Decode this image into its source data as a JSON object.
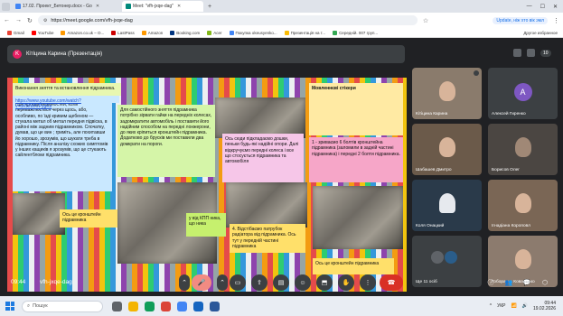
{
  "browser": {
    "tabs": [
      {
        "label": "17.02. Проект_Бетонер.docx - Go",
        "color": "#4285f4"
      },
      {
        "label": "Meet: \"vfh-jxqe-dag\"",
        "color": "#00897b",
        "active": true
      }
    ],
    "new_tab": "+",
    "url": "https://meet.google.com/vfh-jxqe-dag",
    "update_label": "Update, ніж хто вік эмл",
    "bookmarks": [
      {
        "label": "Gmail",
        "color": "#ea4335"
      },
      {
        "label": "YouTube",
        "color": "#ff0000"
      },
      {
        "label": "Amazon.co.uk – O...",
        "color": "#ff9900"
      },
      {
        "label": "LastPass",
        "color": "#cc0000"
      },
      {
        "label": "Amazon",
        "color": "#ff9900"
      },
      {
        "label": "Booking.com",
        "color": "#003580"
      },
      {
        "label": "Acer",
        "color": "#83b81a"
      },
      {
        "label": "Покупка okeusyenko...",
        "color": "#4285f4"
      },
      {
        "label": "Презентація на т...",
        "color": "#fbbc04"
      },
      {
        "label": "Середній. 007 груп...",
        "color": "#34a853"
      }
    ],
    "bookmarks_right": "Другое избранное"
  },
  "meet": {
    "presenter_initial": "K",
    "presenter_label": "Кітіцина Карина (Презентація)",
    "participant_count": "10",
    "time": "09:44",
    "meeting_code": "vfh-jxqe-dag"
  },
  "slide": {
    "title": "Виконання зняття та встановлення підрамника.",
    "note1": "При проїзді нерівностей, коли переважлюється через щось, або, особливо, по їзді кривим щебеном — стукала метал об метал передня підвіска, в районі між задним підрамником. Спочатку, думав, що це вин ; гриміть, але похитавши йо хорошо, зрозумів, що шукати треба в підрамнику. Після аналізу схожих симптомів у інших кащиків я зрозумів, що це стукають сайлентблоки підрамника.",
    "link": "https://www.youtube.com/watch?v=oKWWfVPygKs",
    "note2": "Для самостійного зняття підрамника потрібно зірвати гайки на передніх колесах, задомкратити автомобіль і поставити його надійним способом на передні лонжерони, до яких кріпиться кронштейн підрамника. Додатково до брусків ми поставили два домкрати на пороги.",
    "note3": "Ось сюди підкладаємо дошки, пеньки будь-які надійні опори. Далі відкручуємо передні колеса і все що стосується підрамника та автомобіля",
    "note4": "1 - зриваємо 6 болтів кронштейна підрамника (заломили в задній частині підрамника) і передні 2 болти підрамника.",
    "note5": "Ось це кронштейн підрамника",
    "note6": "4. Відстібаємо патрубок радіатора від підрамника. Ось тут у передній частині підрамника",
    "note7": "у від КПП ника, що ника",
    "note8": "Ось це кронштейн підрамника",
    "sticky_title": "Мовленнєві стікери"
  },
  "participants": [
    {
      "name": "Кітіцина Карина",
      "type": "video",
      "bg": "#8a7b6c"
    },
    {
      "name": "Алексей Гиренко",
      "type": "avatar",
      "initial": "A",
      "bg": "#3c4043",
      "avatar_color": "#7e57c2"
    },
    {
      "name": "Шабашев Дмитро",
      "type": "video",
      "bg": "#6b5a4a"
    },
    {
      "name": "Борисов Олег",
      "type": "video",
      "bg": "#4b4642"
    },
    {
      "name": "Коля Онацкий",
      "type": "video",
      "bg": "#2a3a4a"
    },
    {
      "name": "Ігнадіана Короповл",
      "type": "video",
      "bg": "#7a6655"
    },
    {
      "name": "Ще 11 осіб",
      "type": "more",
      "bg": "#3c4043"
    },
    {
      "name": "Гоборакьа Коваренко",
      "type": "video",
      "bg": "#8c7b6e"
    }
  ],
  "taskbar": {
    "search_placeholder": "Пошук",
    "lang": "УКР",
    "clock_time": "09:44",
    "clock_date": "19.02.2026"
  },
  "colors": {
    "accent": "#1a73e8",
    "end_call": "#d93025",
    "mic_off": "#f28b82"
  }
}
